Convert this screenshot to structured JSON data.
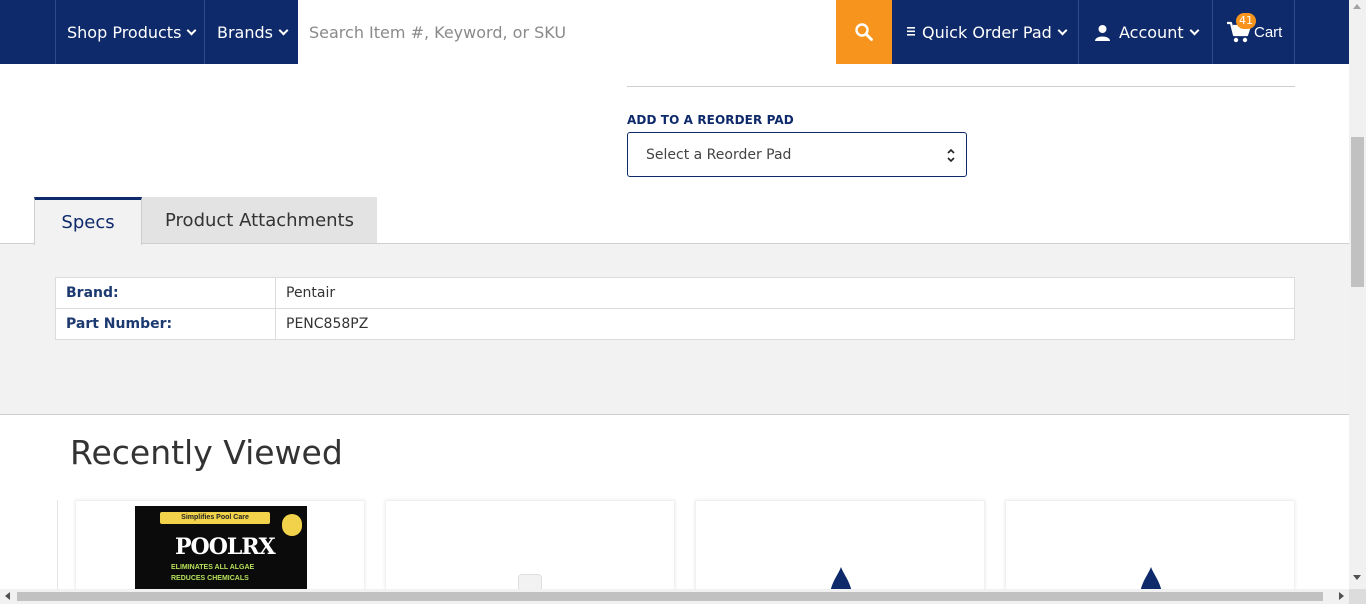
{
  "nav": {
    "shop_products": "Shop Products",
    "brands": "Brands",
    "search_placeholder": "Search Item #, Keyword, or SKU",
    "quick_order_pad": "Quick Order Pad",
    "account": "Account",
    "cart": "Cart",
    "cart_count": "41"
  },
  "reorder": {
    "label": "ADD TO A REORDER PAD",
    "select_value": "Select a Reorder Pad"
  },
  "tabs": [
    {
      "label": "Specs",
      "active": true
    },
    {
      "label": "Product Attachments",
      "active": false
    }
  ],
  "specs": [
    {
      "key": "Brand:",
      "value": "Pentair"
    },
    {
      "key": "Part Number:",
      "value": "PENC858PZ"
    }
  ],
  "recently_viewed": {
    "title": "Recently Viewed",
    "product_image_text": {
      "top": "Simplifies Pool Care",
      "brand": "POOLRX",
      "line1": "ELIMINATES ALL ALGAE",
      "line2": "REDUCES CHEMICALS"
    }
  },
  "colors": {
    "navy": "#0e2a6b",
    "accent_orange": "#f7941d"
  }
}
